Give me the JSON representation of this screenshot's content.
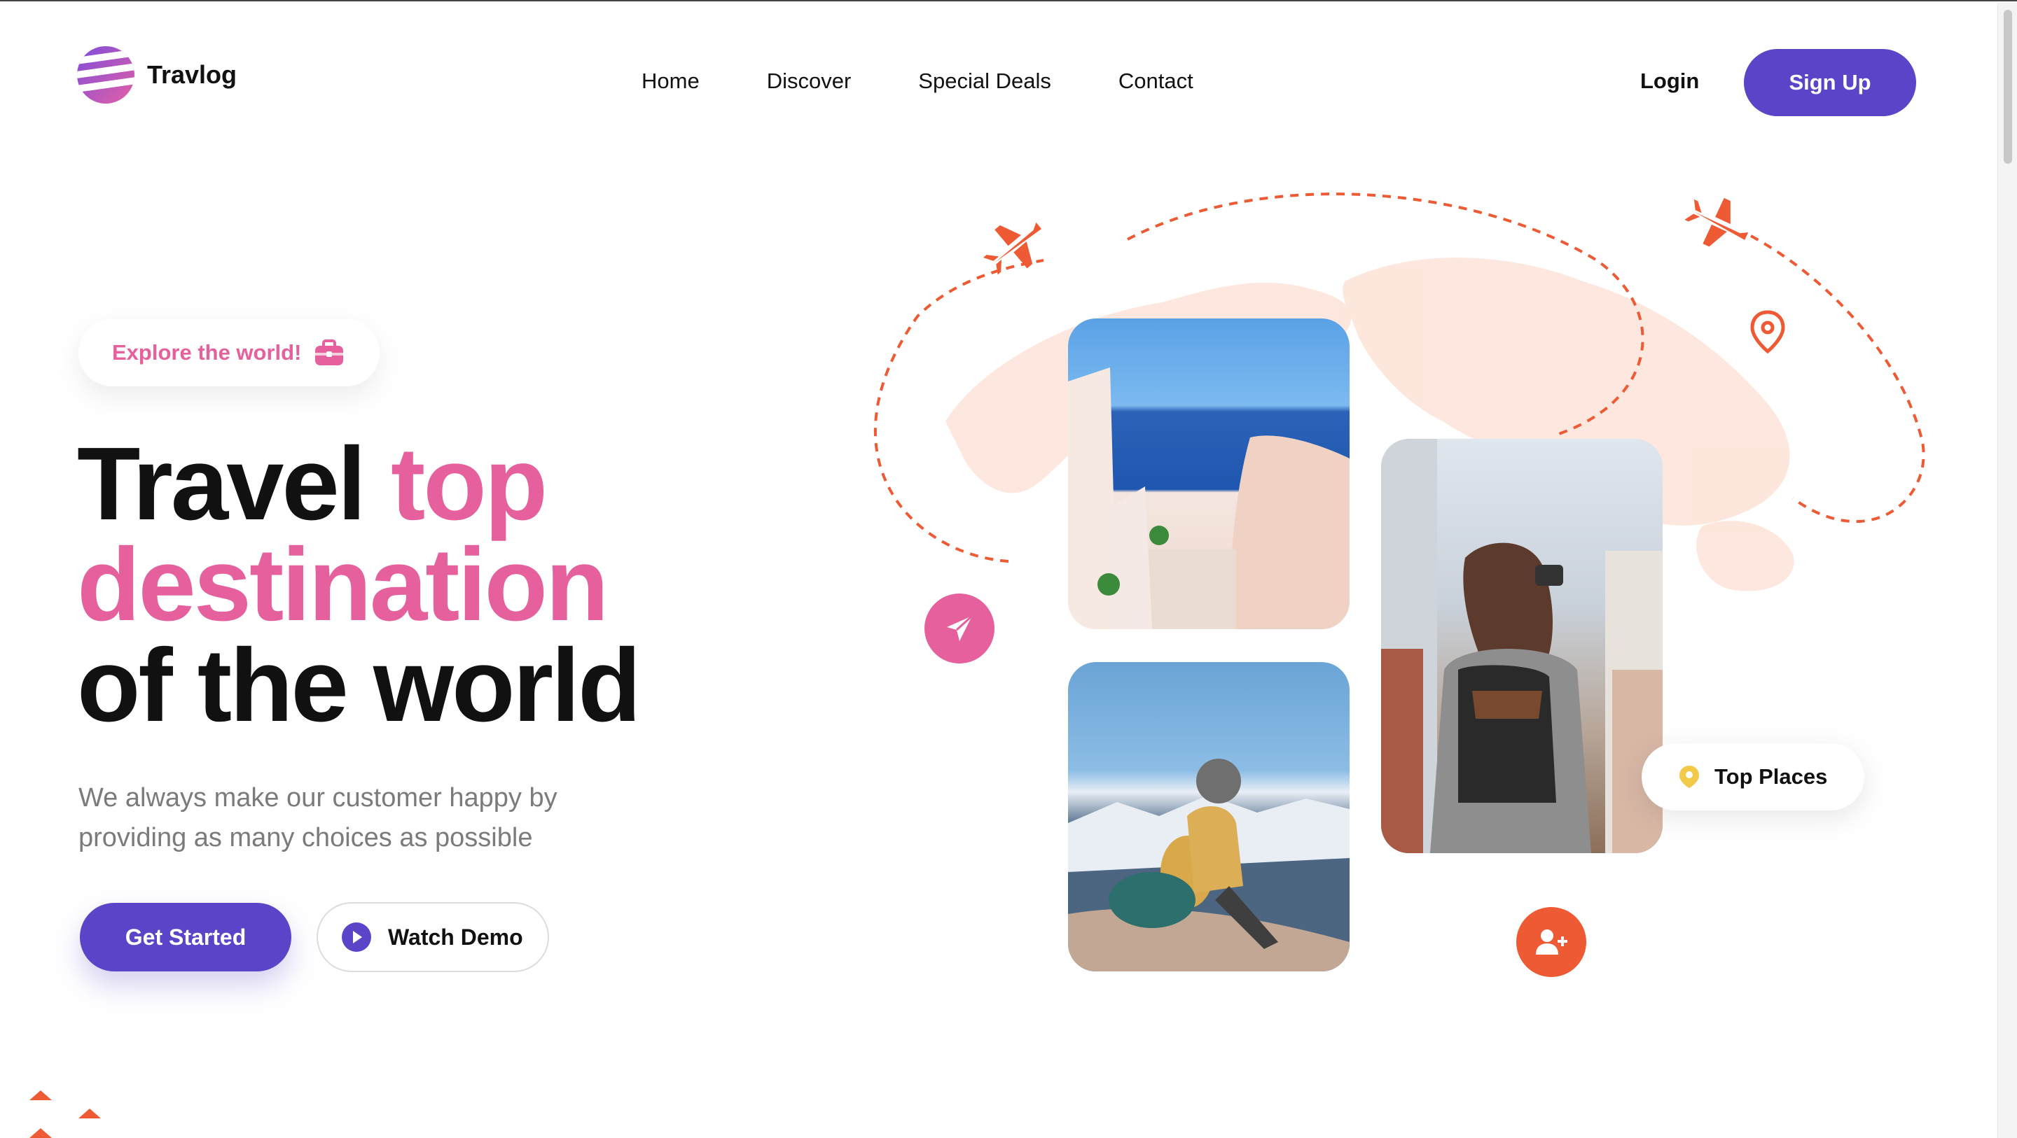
{
  "brand": {
    "name": "Travlog"
  },
  "nav": {
    "items": [
      {
        "label": "Home"
      },
      {
        "label": "Discover"
      },
      {
        "label": "Special Deals"
      },
      {
        "label": "Contact"
      }
    ]
  },
  "auth": {
    "login": "Login",
    "signup": "Sign Up"
  },
  "hero": {
    "badge": "Explore the world!",
    "title_line1_a": "Travel",
    "title_line1_b": "top",
    "title_line2": "destination",
    "title_line3": "of the world",
    "subtitle": "We always make our customer happy by providing as many choices as possible",
    "cta_primary": "Get Started",
    "cta_secondary": "Watch Demo"
  },
  "gallery": {
    "badge": "Top Places"
  },
  "colors": {
    "primary": "#5b44c8",
    "accent_pink": "#e5609c",
    "accent_orange": "#ee5a34",
    "map_tint": "#fde3d8"
  },
  "icons": [
    "briefcase-icon",
    "play-icon",
    "paper-plane-icon",
    "user-plus-icon",
    "location-pin-icon",
    "airplane-icon"
  ]
}
